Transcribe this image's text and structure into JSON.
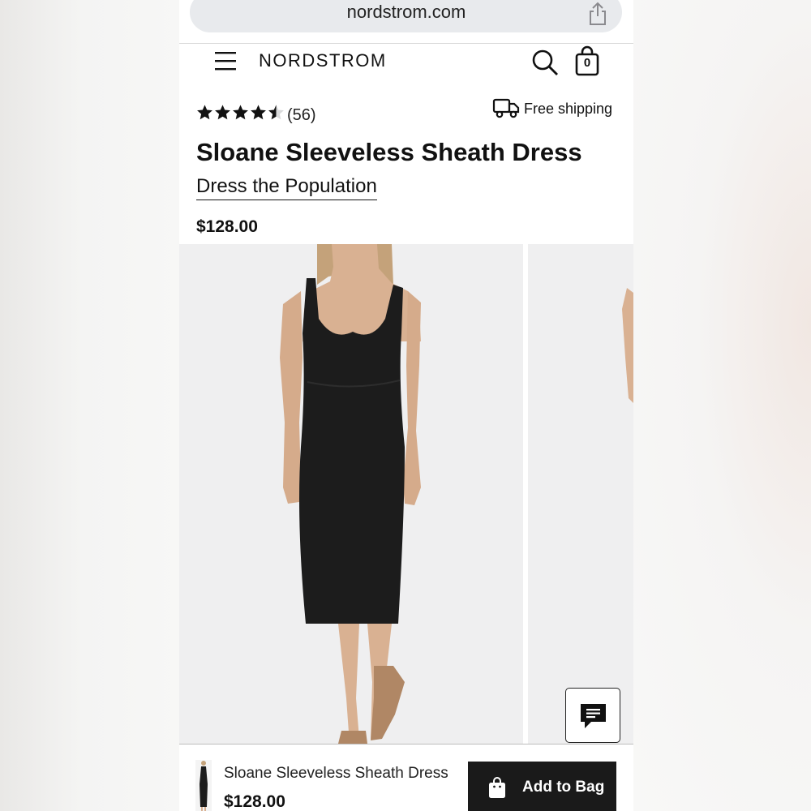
{
  "browser": {
    "url": "nordstrom.com",
    "share_icon": "share-icon"
  },
  "header": {
    "brand": "NORDSTROM",
    "menu_icon": "hamburger-menu-icon",
    "search_icon": "search-icon",
    "bag_icon": "shopping-bag-icon",
    "bag_count": "0"
  },
  "product": {
    "rating": 4.5,
    "rating_max": 5,
    "review_count": "(56)",
    "shipping_label": "Free shipping",
    "title": "Sloane Sleeveless Sheath Dress",
    "brand": "Dress the Population",
    "price": "$128.00"
  },
  "chat": {
    "icon": "chat-icon"
  },
  "sticky_bar": {
    "name": "Sloane Sleeveless Sheath Dress",
    "price": "$128.00",
    "button_label": "Add to Bag",
    "button_icon": "shopping-bag-icon"
  },
  "colors": {
    "primary": "#111111",
    "button_bg": "#1a1a1a",
    "star_empty": "#d9dadb",
    "image_bg": "#efeff0"
  }
}
